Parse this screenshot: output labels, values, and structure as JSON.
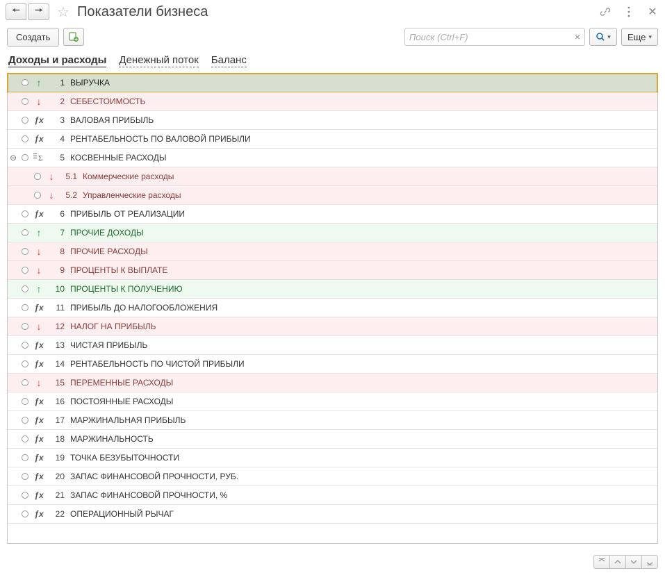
{
  "header": {
    "title": "Показатели бизнеса"
  },
  "toolbar": {
    "create_label": "Создать",
    "search_placeholder": "Поиск (Ctrl+F)",
    "more_label": "Еще"
  },
  "tabs": [
    {
      "label": "Доходы и расходы",
      "active": true
    },
    {
      "label": "Денежный поток",
      "active": false
    },
    {
      "label": "Баланс",
      "active": false
    }
  ],
  "rows": [
    {
      "num": "1",
      "label": "ВЫРУЧКА",
      "type": "up",
      "tone": "selected",
      "child": false
    },
    {
      "num": "2",
      "label": "СЕБЕСТОИМОСТЬ",
      "type": "down",
      "tone": "pink",
      "child": false
    },
    {
      "num": "3",
      "label": "ВАЛОВАЯ ПРИБЫЛЬ",
      "type": "fx",
      "tone": "",
      "child": false
    },
    {
      "num": "4",
      "label": "РЕНТАБЕЛЬНОСТЬ ПО ВАЛОВОЙ ПРИБЫЛИ",
      "type": "fx",
      "tone": "",
      "child": false
    },
    {
      "num": "5",
      "label": "КОСВЕННЫЕ РАСХОДЫ",
      "type": "sigma",
      "tone": "",
      "child": false,
      "expandable": true
    },
    {
      "num": "5.1",
      "label": "Коммерческие расходы",
      "type": "down",
      "tone": "pink",
      "child": true
    },
    {
      "num": "5.2",
      "label": "Управленческие расходы",
      "type": "down",
      "tone": "pink",
      "child": true
    },
    {
      "num": "6",
      "label": "ПРИБЫЛЬ ОТ РЕАЛИЗАЦИИ",
      "type": "fx",
      "tone": "",
      "child": false
    },
    {
      "num": "7",
      "label": "ПРОЧИЕ ДОХОДЫ",
      "type": "up",
      "tone": "green",
      "child": false
    },
    {
      "num": "8",
      "label": "ПРОЧИЕ РАСХОДЫ",
      "type": "down",
      "tone": "pink",
      "child": false
    },
    {
      "num": "9",
      "label": "ПРОЦЕНТЫ К ВЫПЛАТЕ",
      "type": "down",
      "tone": "pink",
      "child": false
    },
    {
      "num": "10",
      "label": "ПРОЦЕНТЫ К ПОЛУЧЕНИЮ",
      "type": "up",
      "tone": "green",
      "child": false
    },
    {
      "num": "11",
      "label": "ПРИБЫЛЬ ДО НАЛОГООБЛОЖЕНИЯ",
      "type": "fx",
      "tone": "",
      "child": false
    },
    {
      "num": "12",
      "label": "НАЛОГ НА ПРИБЫЛЬ",
      "type": "down",
      "tone": "pink",
      "child": false
    },
    {
      "num": "13",
      "label": "ЧИСТАЯ ПРИБЫЛЬ",
      "type": "fx",
      "tone": "",
      "child": false
    },
    {
      "num": "14",
      "label": "РЕНТАБЕЛЬНОСТЬ ПО ЧИСТОЙ ПРИБЫЛИ",
      "type": "fx",
      "tone": "",
      "child": false
    },
    {
      "num": "15",
      "label": "ПЕРЕМЕННЫЕ РАСХОДЫ",
      "type": "down",
      "tone": "pink",
      "child": false
    },
    {
      "num": "16",
      "label": "ПОСТОЯННЫЕ РАСХОДЫ",
      "type": "fx",
      "tone": "",
      "child": false
    },
    {
      "num": "17",
      "label": "МАРЖИНАЛЬНАЯ ПРИБЫЛЬ",
      "type": "fx",
      "tone": "",
      "child": false
    },
    {
      "num": "18",
      "label": "МАРЖИНАЛЬНОСТЬ",
      "type": "fx",
      "tone": "",
      "child": false
    },
    {
      "num": "19",
      "label": "ТОЧКА БЕЗУБЫТОЧНОСТИ",
      "type": "fx",
      "tone": "",
      "child": false
    },
    {
      "num": "20",
      "label": "ЗАПАС ФИНАНСОВОЙ ПРОЧНОСТИ, РУБ.",
      "type": "fx",
      "tone": "",
      "child": false
    },
    {
      "num": "21",
      "label": "ЗАПАС ФИНАНСОВОЙ ПРОЧНОСТИ, %",
      "type": "fx",
      "tone": "",
      "child": false
    },
    {
      "num": "22",
      "label": "ОПЕРАЦИОННЫЙ РЫЧАГ",
      "type": "fx",
      "tone": "",
      "child": false
    }
  ]
}
